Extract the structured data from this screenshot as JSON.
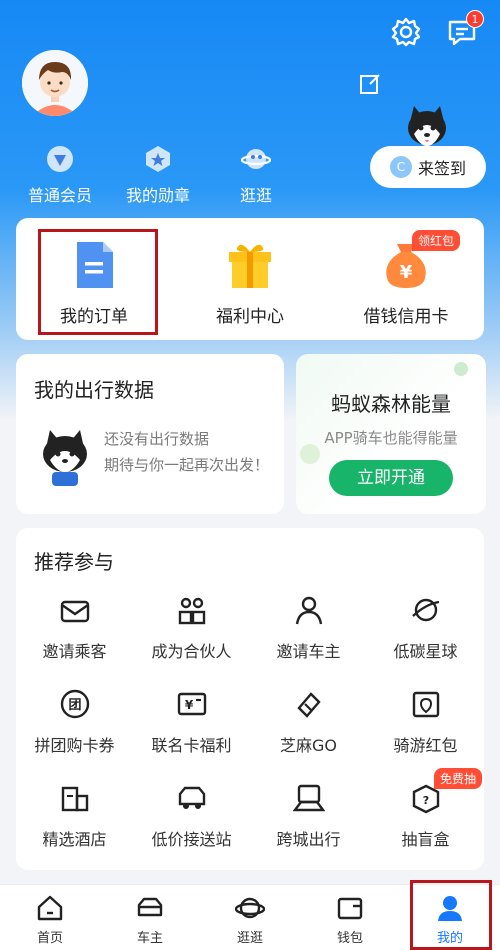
{
  "header": {
    "message_badge_count": "1",
    "profile_links": [
      {
        "label": "普通会员",
        "icon": "member-icon"
      },
      {
        "label": "我的勋章",
        "icon": "medal-icon"
      },
      {
        "label": "逛逛",
        "icon": "planet-icon"
      }
    ],
    "signin": {
      "label": "来签到",
      "badge_letter": "C"
    }
  },
  "quick": [
    {
      "label": "我的订单",
      "icon": "order-doc-icon"
    },
    {
      "label": "福利中心",
      "icon": "gift-icon"
    },
    {
      "label": "借钱信用卡",
      "icon": "money-bag-icon",
      "badge": "领红包"
    }
  ],
  "travel_data": {
    "title": "我的出行数据",
    "line1": "还没有出行数据",
    "line2": "期待与你一起再次出发！"
  },
  "forest": {
    "title": "蚂蚁森林能量",
    "subtitle": "APP骑车也能得能量",
    "button": "立即开通"
  },
  "recommend": {
    "title": "推荐参与",
    "items": [
      {
        "label": "邀请乘客",
        "icon": "invite-passenger-icon"
      },
      {
        "label": "成为合伙人",
        "icon": "partner-icon"
      },
      {
        "label": "邀请车主",
        "icon": "invite-driver-icon"
      },
      {
        "label": "低碳星球",
        "icon": "planet-icon"
      },
      {
        "label": "拼团购卡券",
        "icon": "group-buy-icon"
      },
      {
        "label": "联名卡福利",
        "icon": "cobrand-card-icon"
      },
      {
        "label": "芝麻GO",
        "icon": "sesame-go-icon"
      },
      {
        "label": "骑游红包",
        "icon": "ride-redpacket-icon"
      },
      {
        "label": "精选酒店",
        "icon": "hotel-icon"
      },
      {
        "label": "低价接送站",
        "icon": "shuttle-icon"
      },
      {
        "label": "跨城出行",
        "icon": "intercity-icon"
      },
      {
        "label": "抽盲盒",
        "icon": "blind-box-icon",
        "badge": "免费抽"
      }
    ]
  },
  "tabs": [
    {
      "label": "首页",
      "icon": "home-icon"
    },
    {
      "label": "车主",
      "icon": "car-icon"
    },
    {
      "label": "逛逛",
      "icon": "planet-icon"
    },
    {
      "label": "钱包",
      "icon": "wallet-icon"
    },
    {
      "label": "我的",
      "icon": "profile-icon"
    }
  ],
  "colors": {
    "primary": "#1677ff",
    "green": "#17b46a",
    "badge_red": "#ff4d36",
    "highlight": "#b8161a"
  }
}
